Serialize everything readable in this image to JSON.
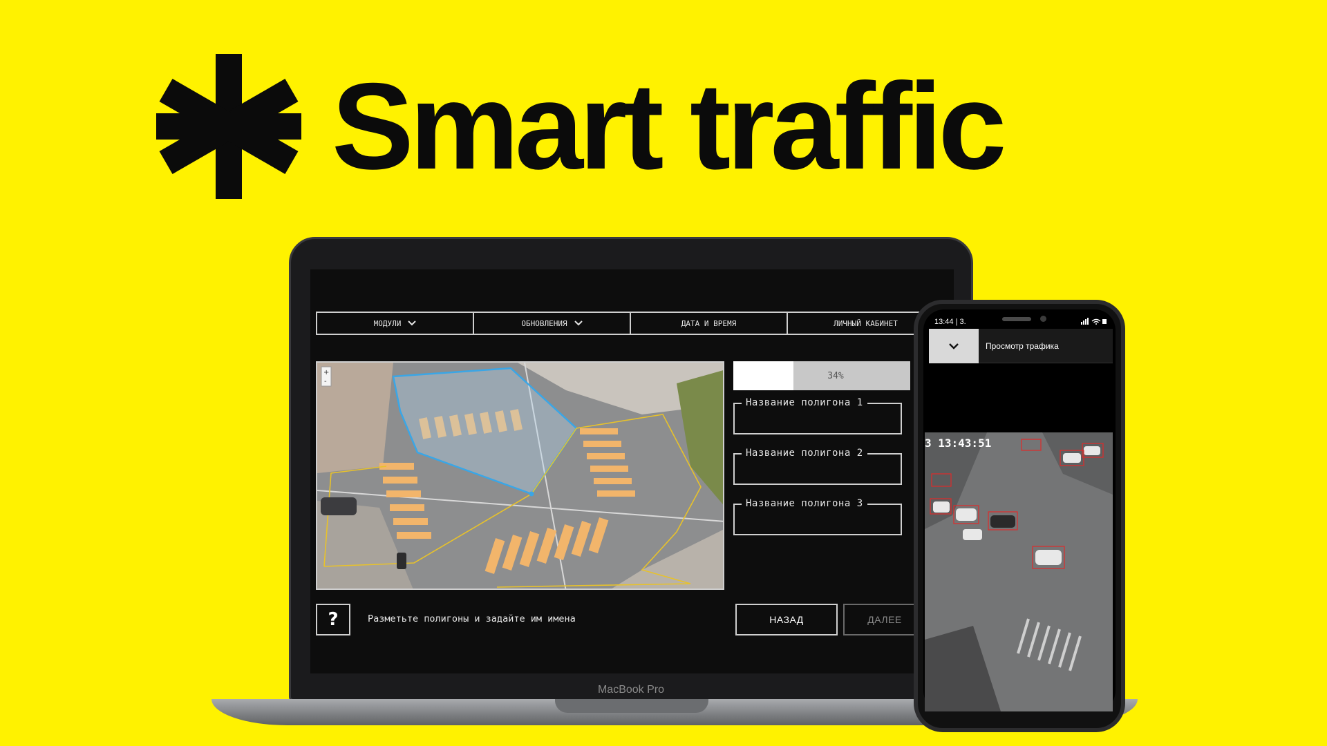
{
  "headline": {
    "title": "Smart traffic"
  },
  "laptop": {
    "brand_label": "MacBook Pro",
    "nav": [
      {
        "label": "МОДУЛИ",
        "has_dropdown": true
      },
      {
        "label": "ОБНОВЛЕНИЯ",
        "has_dropdown": true
      },
      {
        "label": "ДАТА И ВРЕМЯ",
        "has_dropdown": false
      },
      {
        "label": "ЛИЧНЫЙ КАБИНЕТ",
        "has_dropdown": false
      }
    ],
    "progress": {
      "percent": 34,
      "label": "34%"
    },
    "polygon_fields": [
      {
        "label": "Название полигона 1",
        "value": ""
      },
      {
        "label": "Название полигона 2",
        "value": ""
      },
      {
        "label": "Название полигона 3",
        "value": ""
      }
    ],
    "help_label": "?",
    "instruction": "Разметьте полигоны и задайте им имена",
    "back_label": "НАЗАД",
    "next_label": "ДАЛЕЕ"
  },
  "phone": {
    "status_time": "13:44 | 3.",
    "header_title": "Просмотр трафика",
    "camera_timestamp": "3 13:43:51"
  },
  "colors": {
    "background": "#FFF200",
    "polygon_blue": "#3aa6e6",
    "polygon_yellow": "#e8c22a",
    "crosswalk": "#f2b56b",
    "detection_box": "#e02a2a"
  }
}
